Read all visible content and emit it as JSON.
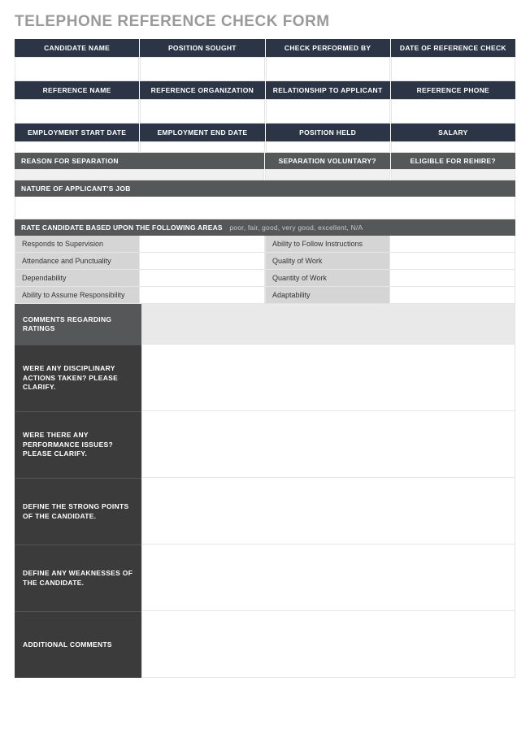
{
  "title": "TELEPHONE REFERENCE CHECK FORM",
  "section1": {
    "h0": "CANDIDATE NAME",
    "h1": "POSITION SOUGHT",
    "h2": "CHECK PERFORMED BY",
    "h3": "DATE OF REFERENCE CHECK"
  },
  "section2": {
    "h0": "REFERENCE NAME",
    "h1": "REFERENCE ORGANIZATION",
    "h2": "RELATIONSHIP TO APPLICANT",
    "h3": "REFERENCE PHONE"
  },
  "section3": {
    "h0": "EMPLOYMENT START DATE",
    "h1": "EMPLOYMENT END DATE",
    "h2": "POSITION HELD",
    "h3": "SALARY"
  },
  "section4": {
    "h0": "REASON FOR SEPARATION",
    "h1": "SEPARATION VOLUNTARY?",
    "h2": "ELIGIBLE FOR REHIRE?"
  },
  "nature_label": "NATURE OF APPLICANT'S JOB",
  "rate": {
    "label": "RATE CANDIDATE BASED UPON THE FOLLOWING AREAS",
    "scale": "poor, fair, good, very good, excellent, N/A",
    "rows": [
      {
        "a": "Responds to Supervision",
        "b": "Ability to Follow Instructions"
      },
      {
        "a": "Attendance and Punctuality",
        "b": "Quality of Work"
      },
      {
        "a": "Dependability",
        "b": "Quantity of Work"
      },
      {
        "a": "Ability to Assume Responsibility",
        "b": "Adaptability"
      }
    ]
  },
  "questions": {
    "q0": "COMMENTS REGARDING RATINGS",
    "q1": "WERE ANY DISCIPLINARY ACTIONS TAKEN? PLEASE CLARIFY.",
    "q2": "WERE THERE ANY PERFORMANCE ISSUES? PLEASE CLARIFY.",
    "q3": "DEFINE THE STRONG POINTS OF THE CANDIDATE.",
    "q4": "DEFINE ANY WEAKNESSES OF THE CANDIDATE.",
    "q5": "ADDITIONAL COMMENTS"
  }
}
